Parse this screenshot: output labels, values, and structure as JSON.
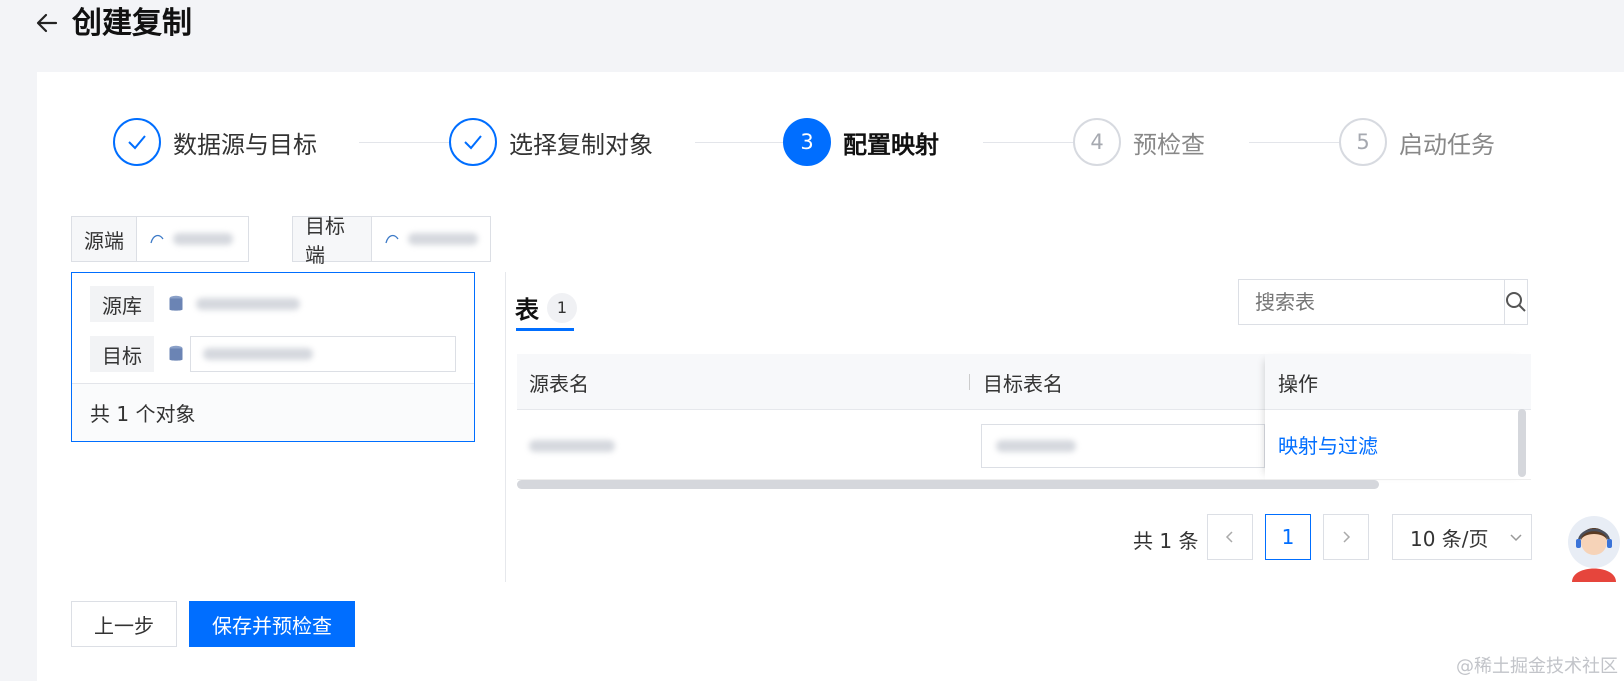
{
  "header": {
    "title": "创建复制",
    "back_icon": "arrow-left-icon"
  },
  "steps": [
    {
      "index": "1",
      "label": "数据源与目标",
      "status": "done"
    },
    {
      "index": "2",
      "label": "选择复制对象",
      "status": "done"
    },
    {
      "index": "3",
      "label": "配置映射",
      "status": "active"
    },
    {
      "index": "4",
      "label": "预检查",
      "status": "todo"
    },
    {
      "index": "5",
      "label": "启动任务",
      "status": "todo"
    }
  ],
  "endpoints": {
    "source_label": "源端",
    "target_label": "目标端"
  },
  "db_panel": {
    "source_label": "源库",
    "target_label": "目标",
    "summary": "共 1 个对象"
  },
  "tab": {
    "label": "表",
    "count": "1"
  },
  "search": {
    "placeholder": "搜索表"
  },
  "table": {
    "columns": [
      "源表名",
      "目标表名",
      "操作"
    ],
    "rows": [
      {
        "action": "映射与过滤"
      }
    ]
  },
  "pagination": {
    "total": "共 1 条",
    "current_page": "1",
    "page_size": "10 条/页"
  },
  "actions": {
    "prev": "上一步",
    "save_precheck": "保存并预检查"
  },
  "watermark": "@稀土掘金技术社区",
  "colors": {
    "primary": "#006eff",
    "border": "#dcdfe5"
  }
}
